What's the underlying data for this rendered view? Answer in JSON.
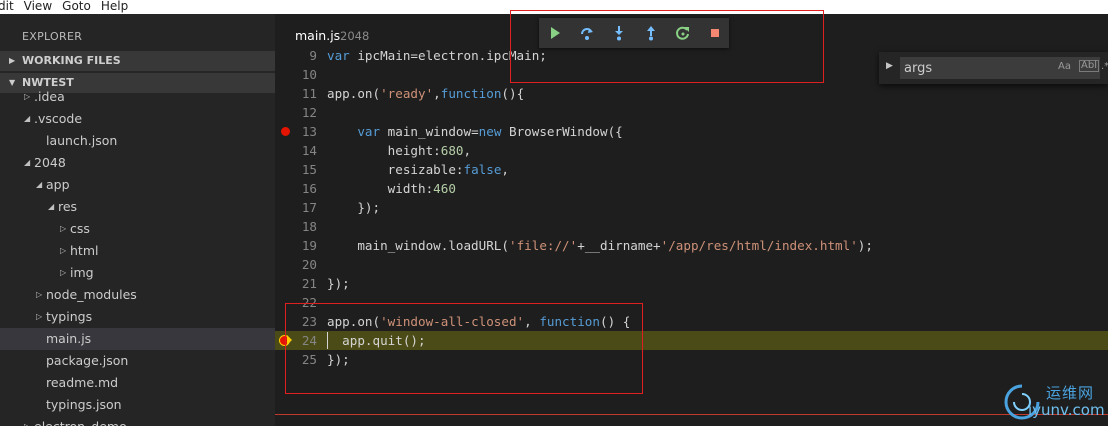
{
  "menubar": {
    "items": [
      "dit",
      "View",
      "Goto",
      "Help"
    ]
  },
  "sidebar": {
    "title": "EXPLORER",
    "sections": [
      {
        "label": "WORKING FILES",
        "expanded": false
      },
      {
        "label": "NWTEST",
        "expanded": true
      }
    ],
    "tree": [
      {
        "label": ".idea",
        "toggle": "collapsed",
        "indent": 0
      },
      {
        "label": ".vscode",
        "toggle": "expanded",
        "indent": 0
      },
      {
        "label": "launch.json",
        "toggle": "none",
        "indent": 1
      },
      {
        "label": "2048",
        "toggle": "expanded",
        "indent": 0
      },
      {
        "label": "app",
        "toggle": "expanded",
        "indent": 1
      },
      {
        "label": "res",
        "toggle": "expanded",
        "indent": 2
      },
      {
        "label": "css",
        "toggle": "collapsed",
        "indent": 3
      },
      {
        "label": "html",
        "toggle": "collapsed",
        "indent": 3
      },
      {
        "label": "img",
        "toggle": "collapsed",
        "indent": 3
      },
      {
        "label": "node_modules",
        "toggle": "collapsed",
        "indent": 1
      },
      {
        "label": "typings",
        "toggle": "collapsed",
        "indent": 1
      },
      {
        "label": "main.js",
        "toggle": "none",
        "indent": 1,
        "selected": true
      },
      {
        "label": "package.json",
        "toggle": "none",
        "indent": 1
      },
      {
        "label": "readme.md",
        "toggle": "none",
        "indent": 1
      },
      {
        "label": "typings.json",
        "toggle": "none",
        "indent": 1
      },
      {
        "label": "electron_demo",
        "toggle": "collapsed",
        "indent": 0
      }
    ]
  },
  "editor": {
    "tab_title": "main.js",
    "tab_description": "2048",
    "lines": [
      {
        "num": "9",
        "tokens": [
          [
            "kw",
            "var"
          ],
          [
            "p",
            " ipcMain=electron.ipcMain;"
          ]
        ]
      },
      {
        "num": "10",
        "tokens": []
      },
      {
        "num": "11",
        "tokens": [
          [
            "p",
            "app.on("
          ],
          [
            "str",
            "'ready'"
          ],
          [
            "p",
            ","
          ],
          [
            "kw",
            "function"
          ],
          [
            "p",
            "(){"
          ]
        ]
      },
      {
        "num": "12",
        "tokens": []
      },
      {
        "num": "13",
        "breakpoint": true,
        "tokens": [
          [
            "p",
            "    "
          ],
          [
            "kw",
            "var"
          ],
          [
            "p",
            " main_window="
          ],
          [
            "kw",
            "new"
          ],
          [
            "p",
            " BrowserWindow({"
          ]
        ]
      },
      {
        "num": "14",
        "tokens": [
          [
            "p",
            "        height:"
          ],
          [
            "num",
            "680"
          ],
          [
            "p",
            ","
          ]
        ]
      },
      {
        "num": "15",
        "tokens": [
          [
            "p",
            "        resizable:"
          ],
          [
            "kw",
            "false"
          ],
          [
            "p",
            ","
          ]
        ]
      },
      {
        "num": "16",
        "tokens": [
          [
            "p",
            "        width:"
          ],
          [
            "num",
            "460"
          ]
        ]
      },
      {
        "num": "17",
        "tokens": [
          [
            "p",
            "    });"
          ]
        ]
      },
      {
        "num": "18",
        "tokens": []
      },
      {
        "num": "19",
        "tokens": [
          [
            "p",
            "    main_window.loadURL("
          ],
          [
            "str",
            "'file://'"
          ],
          [
            "p",
            "+__dirname+"
          ],
          [
            "str",
            "'/app/res/html/index.html'"
          ],
          [
            "p",
            ");"
          ]
        ]
      },
      {
        "num": "20",
        "tokens": []
      },
      {
        "num": "21",
        "tokens": [
          [
            "p",
            "});"
          ]
        ]
      },
      {
        "num": "22",
        "tokens": []
      },
      {
        "num": "23",
        "tokens": [
          [
            "p",
            "app.on("
          ],
          [
            "str",
            "'window-all-closed'"
          ],
          [
            "p",
            ", "
          ],
          [
            "kw",
            "function"
          ],
          [
            "p",
            "() {"
          ]
        ]
      },
      {
        "num": "24",
        "current": true,
        "breakpoint": true,
        "tokens": [
          [
            "p",
            "  app.quit();"
          ]
        ]
      },
      {
        "num": "25",
        "tokens": [
          [
            "p",
            "});"
          ]
        ]
      }
    ]
  },
  "debug_toolbar": {
    "buttons": [
      "continue-icon",
      "step-over-icon",
      "step-into-icon",
      "step-out-icon",
      "restart-icon",
      "stop-icon"
    ],
    "colors": {
      "continue": "#89d185",
      "step": "#75beff",
      "stop": "#f48771"
    }
  },
  "find_widget": {
    "value": "args",
    "match_case_label": "Aa",
    "whole_word_label": "Abl",
    "regex_label": ".*"
  },
  "watermark": {
    "cn_text": "运维网",
    "url_text": "iyunv.com"
  },
  "annotation_color": "#e02020"
}
